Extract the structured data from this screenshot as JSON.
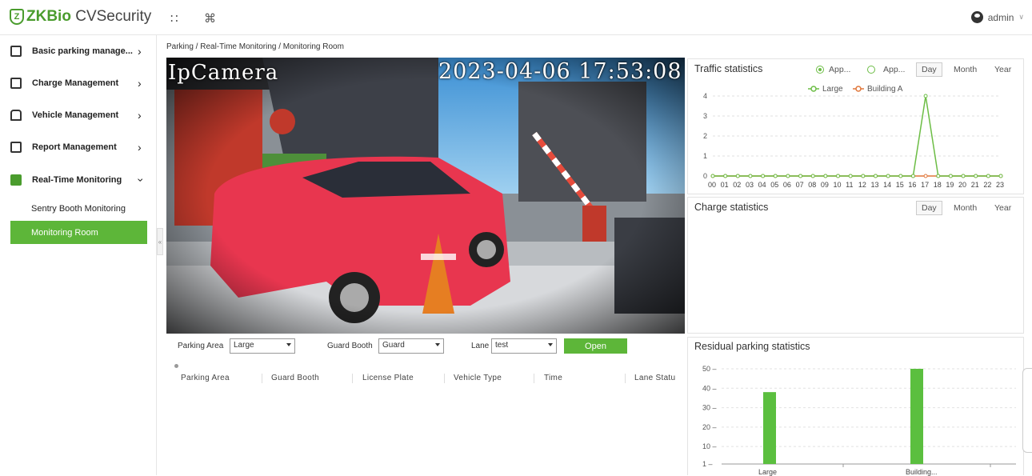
{
  "app": {
    "logo_zk": "ZKBio",
    "logo_rest": " CVSecurity",
    "user": "admin"
  },
  "sidebar": {
    "items": [
      {
        "label": "Basic parking manage...",
        "icon": "parking-icon"
      },
      {
        "label": "Charge Management",
        "icon": "charge-icon"
      },
      {
        "label": "Vehicle Management",
        "icon": "car-icon"
      },
      {
        "label": "Report Management",
        "icon": "report-icon"
      },
      {
        "label": "Real-Time Monitoring",
        "icon": "monitor-icon"
      }
    ],
    "sub_items": [
      "Sentry Booth Monitoring",
      "Monitoring Room"
    ]
  },
  "breadcrumb": "Parking / Real-Time Monitoring / Monitoring Room",
  "camera": {
    "name": "IpCamera",
    "timestamp": "2023-04-06 17:53:08"
  },
  "controls": {
    "parking_area_label": "Parking Area",
    "parking_area_value": "Large",
    "guard_booth_label": "Guard Booth",
    "guard_booth_value": "Guard",
    "lane_label": "Lane",
    "lane_value": "test",
    "open_label": "Open"
  },
  "table": {
    "columns": [
      "Parking Area",
      "Guard Booth",
      "License Plate",
      "Vehicle Type",
      "Time",
      "Lane Statu"
    ]
  },
  "traffic": {
    "title": "Traffic statistics",
    "radio_1": "App...",
    "radio_2": "App...",
    "tabs": [
      "Day",
      "Month",
      "Year"
    ],
    "active_tab": "Day",
    "colors": {
      "large": "#6cbd45",
      "building": "#e0773a"
    }
  },
  "charge": {
    "title": "Charge statistics",
    "tabs": [
      "Day",
      "Month",
      "Year"
    ]
  },
  "residual": {
    "title": "Residual parking statistics"
  },
  "chart_data": [
    {
      "type": "line",
      "x": [
        "00",
        "01",
        "02",
        "03",
        "04",
        "05",
        "06",
        "07",
        "08",
        "09",
        "10",
        "11",
        "12",
        "13",
        "14",
        "15",
        "16",
        "17",
        "18",
        "19",
        "20",
        "21",
        "22",
        "23"
      ],
      "series": [
        {
          "name": "Large",
          "values": [
            0,
            0,
            0,
            0,
            0,
            0,
            0,
            0,
            0,
            0,
            0,
            0,
            0,
            0,
            0,
            0,
            0,
            4,
            0,
            0,
            0,
            0,
            0,
            0
          ]
        },
        {
          "name": "Building A",
          "values": [
            0,
            0,
            0,
            0,
            0,
            0,
            0,
            0,
            0,
            0,
            0,
            0,
            0,
            0,
            0,
            0,
            0,
            0,
            0,
            0,
            0,
            0,
            0,
            0
          ]
        }
      ],
      "y_ticks": [
        "0",
        "1",
        "2",
        "3",
        "4"
      ],
      "ylim": [
        0,
        4
      ]
    },
    {
      "type": "bar",
      "categories": [
        "Large",
        "Building..."
      ],
      "values": [
        38,
        50
      ],
      "y_ticks": [
        "1",
        "10",
        "20",
        "30",
        "40",
        "50"
      ],
      "ylim": [
        1,
        50
      ]
    }
  ]
}
